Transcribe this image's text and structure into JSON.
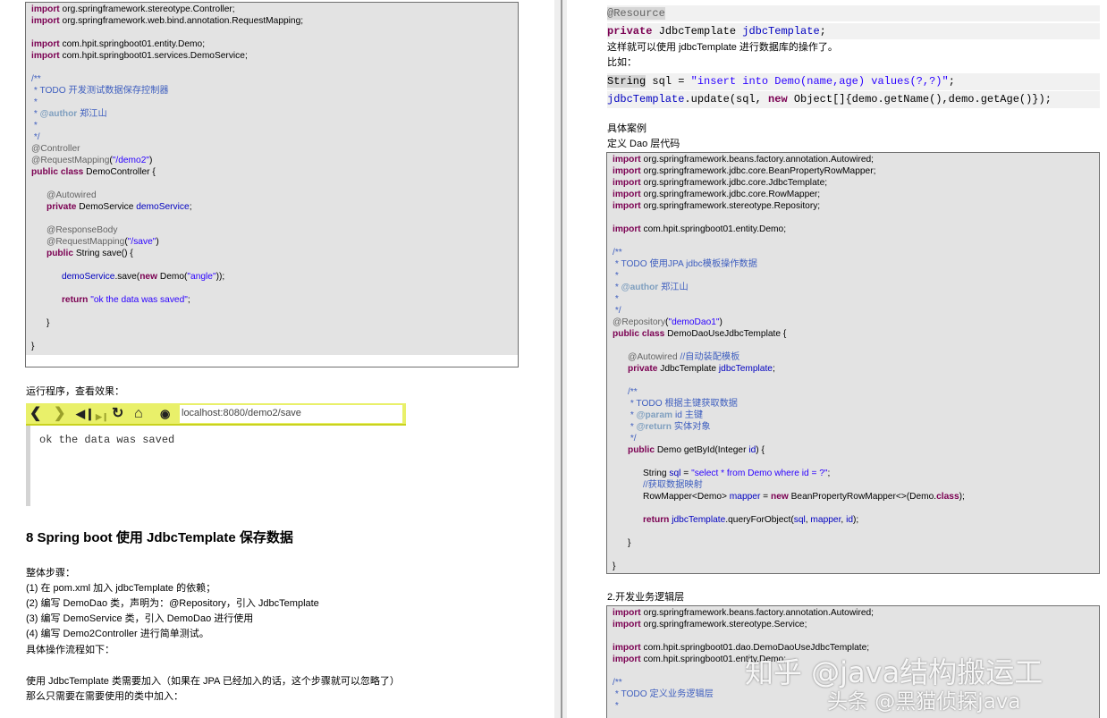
{
  "left": {
    "code1": [
      "import org.springframework.stereotype.Controller;",
      "import org.springframework.web.bind.annotation.RequestMapping;",
      "",
      "import com.hpit.springboot01.entity.Demo;",
      "import com.hpit.springboot01.services.DemoService;",
      "",
      "/**",
      " * TODO 开发测试数据保存控制器",
      " *",
      " * @author 郑江山",
      " *",
      " */",
      "@Controller",
      "@RequestMapping(\"/demo2\")",
      "public class DemoController {",
      "",
      "      @Autowired",
      "      private DemoService demoService;",
      "",
      "      @ResponseBody",
      "      @RequestMapping(\"/save\")",
      "      public String save() {",
      "",
      "            demoService.save(new Demo(\"angle\"));",
      "",
      "            return \"ok the data was saved\";",
      "",
      "      }",
      "",
      "}"
    ],
    "run_label": "运行程序，查看效果：",
    "browser": {
      "url": "localhost:8080/demo2/save",
      "output": "ok the data was saved"
    },
    "section_title": "8   Spring boot  使用 JdbcTemplate 保存数据",
    "steps_title": "整体步骤：",
    "steps": [
      "(1)   在 pom.xml 加入 jdbcTemplate 的依赖；",
      "(2)   编写 DemoDao 类，声明为：@Repository，引入 JdbcTemplate",
      "(3)   编写 DemoService 类，引入 DemoDao 进行使用",
      "(4)   编写 Demo2Controller 进行简单测试。"
    ],
    "flow_label": "具体操作流程如下：",
    "note1": "使用 JdbcTemplate 类需要加入（如果在 JPA 已经加入的话，这个步骤就可以忽略了）",
    "note2": "那么只需要在需要使用的类中加入："
  },
  "right": {
    "resource": "@Resource",
    "private_kw": "private",
    "type": "JdbcTemplate",
    "field": "jdbcTemplate",
    "semi": ";",
    "desc1": "这样就可以使用 jdbcTemplate 进行数据库的操作了。",
    "desc2": "比如：",
    "sql_type": "String",
    "sql_mid": " sql = ",
    "sql_str": "\"insert into Demo(name,age) values(?,?)\"",
    "sql_end": ";",
    "update_field": "jdbcTemplate",
    "update_mid": ".update(sql, ",
    "update_new": "new",
    "update_end": " Object[]{demo.getName(),demo.getAge()});",
    "case_label": "具体案例",
    "dao_label": "定义 Dao 层代码",
    "code2": [
      "import org.springframework.beans.factory.annotation.Autowired;",
      "import org.springframework.jdbc.core.BeanPropertyRowMapper;",
      "import org.springframework.jdbc.core.JdbcTemplate;",
      "import org.springframework.jdbc.core.RowMapper;",
      "import org.springframework.stereotype.Repository;",
      "",
      "import com.hpit.springboot01.entity.Demo;",
      "",
      "/**",
      " * TODO 使用JPA jdbc模板操作数据",
      " *",
      " * @author 郑江山",
      " *",
      " */",
      "@Repository(\"demoDao1\")",
      "public class DemoDaoUseJdbcTemplate {",
      "",
      "      @Autowired //自动装配模板",
      "      private JdbcTemplate jdbcTemplate;",
      "",
      "      /**",
      "       * TODO 根据主键获取数据",
      "       * @param id 主键",
      "       * @return 实体对象",
      "       */",
      "      public Demo getById(Integer id) {",
      "",
      "            String sql = \"select * from Demo where id = ?\";",
      "            //获取数据映射",
      "            RowMapper<Demo> mapper = new BeanPropertyRowMapper<>(Demo.class);",
      "",
      "            return jdbcTemplate.queryForObject(sql, mapper, id);",
      "",
      "      }",
      "",
      "}"
    ],
    "service_label": "2.开发业务逻辑层",
    "code3": [
      "import org.springframework.beans.factory.annotation.Autowired;",
      "import org.springframework.stereotype.Service;",
      "",
      "import com.hpit.springboot01.dao.DemoDaoUseJdbcTemplate;",
      "import com.hpit.springboot01.entity.Demo;",
      "",
      "/**",
      " * TODO 定义业务逻辑层",
      " *"
    ]
  },
  "watermark": {
    "line1": "知乎 @java结构搬运工",
    "line2": "头条 @黑猫侦探java"
  }
}
